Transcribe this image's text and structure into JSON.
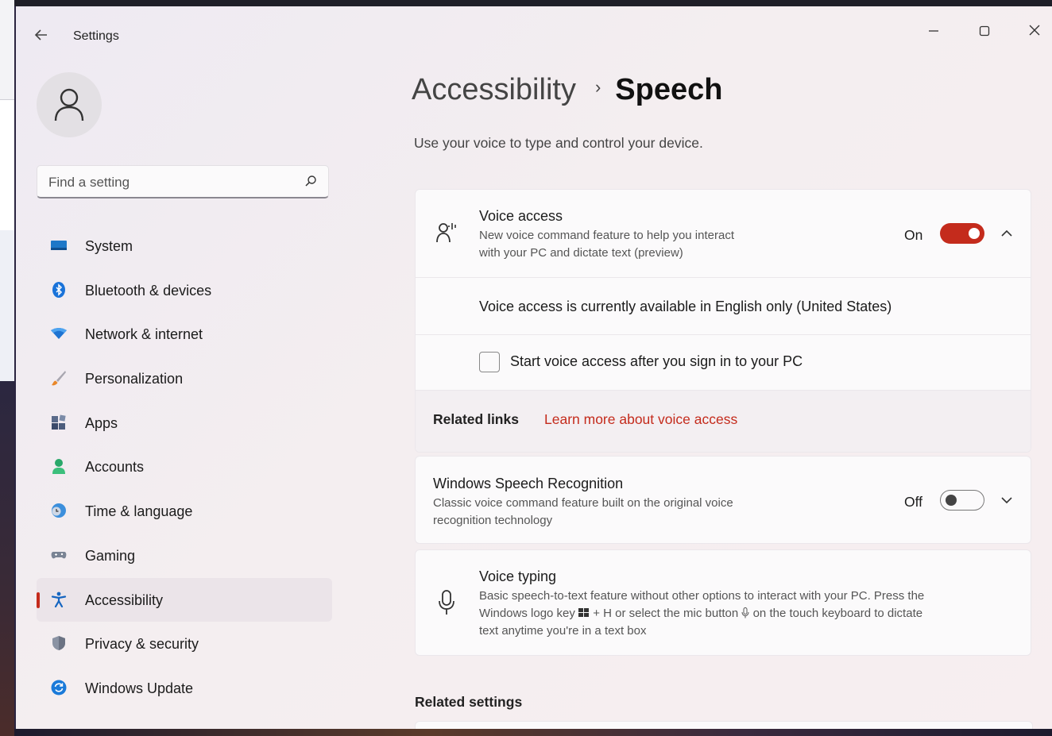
{
  "window": {
    "title": "Settings",
    "controls": {
      "minimize": "—",
      "maximize": "☐",
      "close": "✕"
    }
  },
  "search": {
    "placeholder": "Find a setting"
  },
  "sidebar": {
    "items": [
      {
        "label": "System",
        "icon": "display-icon"
      },
      {
        "label": "Bluetooth & devices",
        "icon": "bluetooth-icon"
      },
      {
        "label": "Network & internet",
        "icon": "wifi-icon"
      },
      {
        "label": "Personalization",
        "icon": "brush-icon"
      },
      {
        "label": "Apps",
        "icon": "apps-icon"
      },
      {
        "label": "Accounts",
        "icon": "account-icon"
      },
      {
        "label": "Time & language",
        "icon": "globe-clock-icon"
      },
      {
        "label": "Gaming",
        "icon": "gamepad-icon"
      },
      {
        "label": "Accessibility",
        "icon": "accessibility-icon",
        "active": true
      },
      {
        "label": "Privacy & security",
        "icon": "shield-icon"
      },
      {
        "label": "Windows Update",
        "icon": "update-icon"
      }
    ]
  },
  "header": {
    "parent": "Accessibility",
    "separator": "›",
    "current": "Speech",
    "description": "Use your voice to type and control your device."
  },
  "voice_access": {
    "title": "Voice access",
    "desc_line1": "New voice command feature to help you interact",
    "desc_line2": "with your PC and dictate text (preview)",
    "state": "On",
    "availability": "Voice access is currently available in English only (United States)",
    "checkbox_label": "Start voice access after you sign in to your PC",
    "related_label": "Related links",
    "related_link": "Learn more about voice access"
  },
  "speech_recognition": {
    "title": "Windows Speech Recognition",
    "desc_line1": "Classic voice command feature built on the original voice",
    "desc_line2": "recognition technology",
    "state": "Off"
  },
  "voice_typing": {
    "title": "Voice typing",
    "desc_line1": "Basic speech-to-text feature without other options to interact with your PC. Press the",
    "desc_line2_a": "Windows logo key",
    "desc_line2_b": "+ H or select the mic button",
    "desc_line2_c": "on the touch keyboard to dictate",
    "desc_line3": "text anytime you're in a text box"
  },
  "related_settings": {
    "heading": "Related settings"
  },
  "colors": {
    "accent": "#c42b1c",
    "window_bg": "#f4eef0",
    "card_bg": "#fbfafb"
  }
}
